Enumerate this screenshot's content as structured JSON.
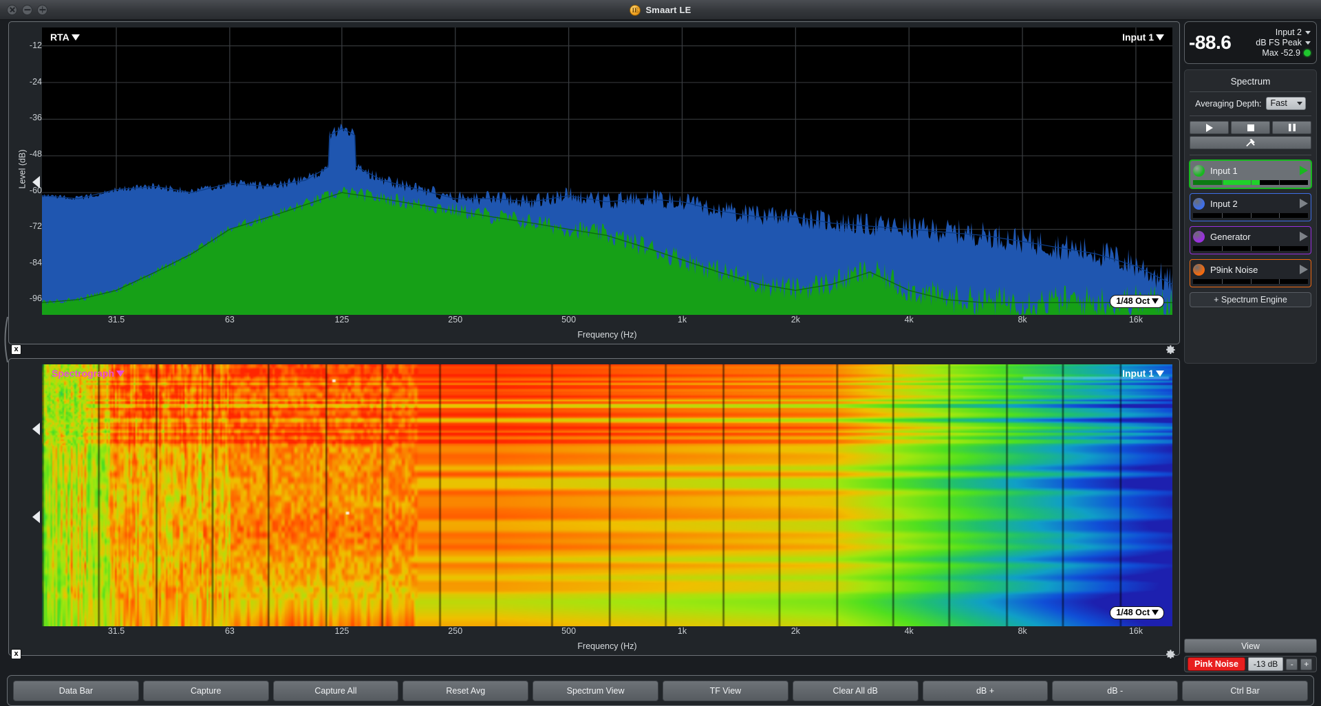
{
  "window": {
    "title": "Smaart LE",
    "app_icon": "smaart-logo-icon",
    "controls": {
      "close": "close-icon",
      "minimize": "minimize-icon",
      "maximize": "maximize-icon"
    }
  },
  "rta": {
    "title": "RTA",
    "source": "Input 1",
    "resolution": "1/48 Oct",
    "y_axis_label": "Level (dB)",
    "x_axis_label": "Frequency (Hz)",
    "y_ticks": [
      "-12",
      "-24",
      "-36",
      "-48",
      "-60",
      "-72",
      "-84",
      "-96"
    ],
    "x_ticks": [
      "31.5",
      "63",
      "125",
      "250",
      "500",
      "1k",
      "2k",
      "4k",
      "8k",
      "16k"
    ],
    "close_label": "x",
    "gear_label": "gear-icon"
  },
  "spectrograph": {
    "title": "Spectrograph",
    "source": "Input 1",
    "resolution": "1/48 Oct",
    "x_axis_label": "Frequency (Hz)",
    "x_ticks": [
      "31.5",
      "63",
      "125",
      "250",
      "500",
      "1k",
      "2k",
      "4k",
      "8k",
      "16k"
    ],
    "close_label": "x",
    "gear_label": "gear-icon"
  },
  "meter": {
    "value": "-88.6",
    "input": "Input 2",
    "unit": "dB FS Peak",
    "max": "Max -52.9",
    "led_color": "#1fc62e"
  },
  "spectrum_panel": {
    "title": "Spectrum",
    "averaging_label": "Averaging Depth:",
    "averaging_value": "Fast",
    "transport": {
      "play": "play-icon",
      "stop": "stop-icon",
      "pause": "pause-icon",
      "tools": "tools-icon"
    },
    "add_engine": "+ Spectrum Engine",
    "engines": [
      {
        "name": "Input 1",
        "color": "#18b81f",
        "selected": true,
        "level": 58
      },
      {
        "name": "Input 2",
        "color": "#3f6fe8",
        "selected": false,
        "level": 0
      },
      {
        "name": "Generator",
        "color": "#9b30e0",
        "selected": false,
        "level": 0
      },
      {
        "name": "P9ink Noise",
        "color": "#f26a10",
        "selected": false,
        "level": 0
      }
    ]
  },
  "view_button": "View",
  "generator_bar": {
    "signal": "Pink Noise",
    "gain": "-13 dB",
    "decrement": "-",
    "increment": "+"
  },
  "toolbar": {
    "buttons": [
      "Data Bar",
      "Capture",
      "Capture All",
      "Reset Avg",
      "Spectrum View",
      "TF View",
      "Clear All dB",
      "dB +",
      "dB -",
      "Ctrl Bar"
    ]
  },
  "chart_data": {
    "type": "area",
    "title": "RTA",
    "xlabel": "Frequency (Hz)",
    "ylabel": "Level (dB)",
    "xscale": "log",
    "xlim": [
      20,
      20000
    ],
    "ylim": [
      -100,
      -6
    ],
    "grid": true,
    "x_tick_values": [
      31.5,
      63,
      125,
      250,
      500,
      1000,
      2000,
      4000,
      8000,
      16000
    ],
    "y_tick_values": [
      -12,
      -24,
      -36,
      -48,
      -60,
      -72,
      -84,
      -96
    ],
    "series": [
      {
        "name": "Input 1",
        "color": "#1f56b0",
        "x": [
          20,
          25,
          31.5,
          40,
          50,
          63,
          80,
          100,
          125,
          160,
          200,
          250,
          315,
          400,
          500,
          630,
          800,
          1000,
          1250,
          1600,
          2000,
          2500,
          3150,
          4000,
          5000,
          6300,
          8000,
          10000,
          12500,
          16000,
          20000
        ],
        "values": [
          -61,
          -62,
          -59,
          -58,
          -60,
          -57,
          -58,
          -56,
          -49,
          -56,
          -59,
          -62,
          -62,
          -63,
          -61,
          -63,
          -62,
          -63,
          -66,
          -68,
          -68,
          -70,
          -71,
          -72,
          -73,
          -74,
          -76,
          -78,
          -80,
          -84,
          -90
        ]
      },
      {
        "name": "Input 2",
        "color": "#16a017",
        "x": [
          20,
          25,
          31.5,
          40,
          50,
          63,
          80,
          100,
          125,
          160,
          200,
          250,
          315,
          400,
          500,
          630,
          800,
          1000,
          1250,
          1600,
          2000,
          2500,
          3150,
          4000,
          5000,
          6300,
          8000,
          10000,
          12500,
          16000,
          20000
        ],
        "values": [
          -96,
          -95,
          -92,
          -86,
          -80,
          -72,
          -68,
          -64,
          -60,
          -62,
          -64,
          -66,
          -68,
          -70,
          -72,
          -74,
          -78,
          -82,
          -86,
          -90,
          -92,
          -90,
          -86,
          -92,
          -95,
          -96,
          -96,
          -96,
          -96,
          -96,
          -96
        ]
      }
    ]
  },
  "spectrograph_data": {
    "type": "heatmap",
    "colormap": [
      "#2018a8",
      "#1050d8",
      "#10a0c8",
      "#20c070",
      "#50e020",
      "#a0e810",
      "#f0c000",
      "#ff7000",
      "#ff2000"
    ],
    "xlabel": "Frequency (Hz)"
  }
}
